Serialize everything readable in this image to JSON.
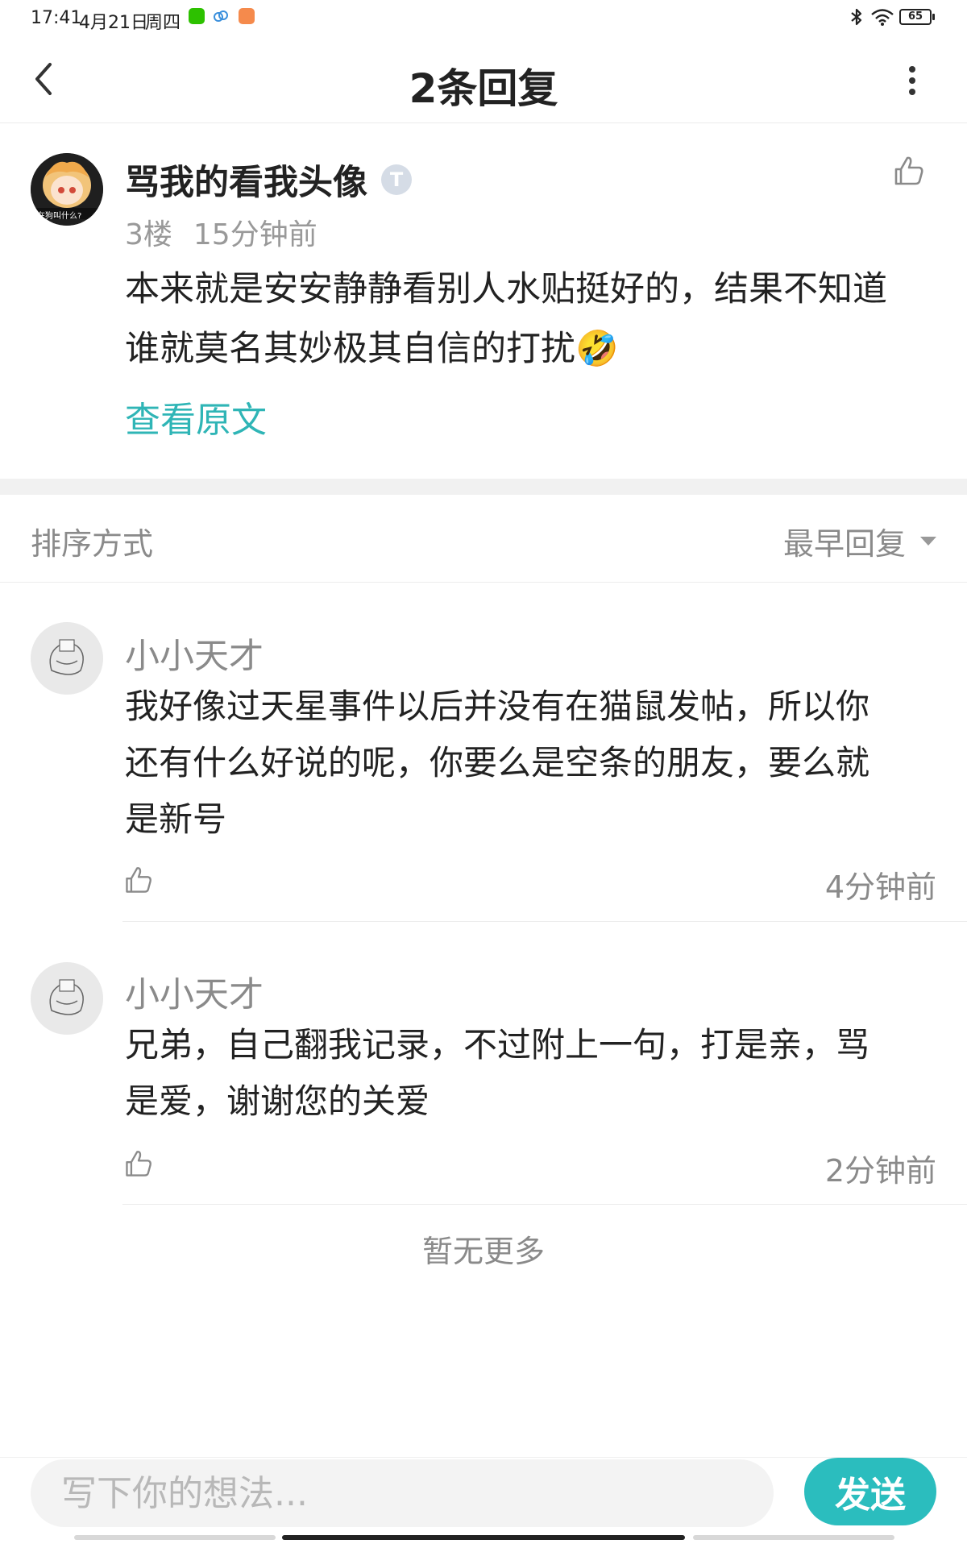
{
  "status_bar": {
    "time": "17:41",
    "date": "4月21日",
    "weekday": "周四",
    "battery": "65"
  },
  "header": {
    "title": "2条回复"
  },
  "main_post": {
    "username": "骂我的看我头像",
    "badge_letter": "T",
    "floor": "3楼",
    "time": "15分钟前",
    "text_line1": "本来就是安安静静看别人水贴挺好的，结果不知道",
    "text_line2": "谁就莫名其妙极其自信的打扰🤣",
    "avatar_caption": "在狗叫什么?",
    "view_original": "查看原文"
  },
  "sort": {
    "label": "排序方式",
    "value": "最早回复"
  },
  "replies": [
    {
      "username": "小小天才",
      "line1": "我好像过天星事件以后并没有在猫鼠发帖，所以你",
      "line2": "还有什么好说的呢，你要么是空条的朋友，要么就",
      "line3": "是新号",
      "time": "4分钟前"
    },
    {
      "username": "小小天才",
      "line1": "兄弟，自己翻我记录，不过附上一句，打是亲，骂",
      "line2": "是爱，谢谢您的关爱",
      "time": "2分钟前"
    }
  ],
  "footer": {
    "no_more": "暂无更多"
  },
  "composer": {
    "placeholder": "写下你的想法...",
    "send": "发送"
  },
  "colors": {
    "accent": "#2bbdbe",
    "link": "#2fb5b6",
    "muted": "#8a8a8a",
    "divider": "#f1f1f1"
  },
  "icons": [
    "back-arrow-icon",
    "more-vertical-icon",
    "thumbs-up-icon",
    "bluetooth-icon",
    "wifi-icon",
    "battery-icon",
    "chevron-down-icon"
  ]
}
